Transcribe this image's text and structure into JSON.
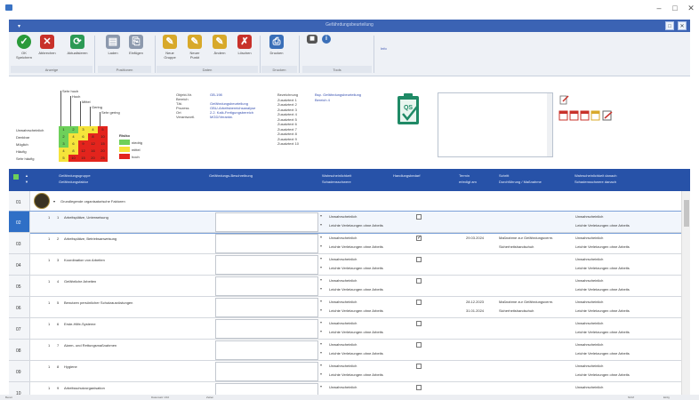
{
  "window": {
    "title": "Gefährdungsbeurteilung",
    "controls": {
      "minimize": "–",
      "maximize": "□",
      "close": "✕"
    }
  },
  "ribbon": {
    "groups": [
      {
        "name": "Anzeige",
        "buttons": [
          {
            "label": "OK Speichern",
            "icon": "check-icon",
            "color": "#2a9a3a"
          },
          {
            "label": "Abbrechen",
            "icon": "close-icon",
            "color": "#c8312a"
          },
          {
            "label": "Aktualisieren",
            "icon": "refresh-icon",
            "color": "#2c9a55"
          }
        ]
      },
      {
        "name": "Positionen",
        "buttons": [
          {
            "label": "Laden",
            "icon": "load-icon",
            "color": "#8c99ad"
          },
          {
            "label": "Einfügen",
            "icon": "insert-icon",
            "color": "#8c99ad"
          }
        ]
      },
      {
        "name": "Daten",
        "buttons": [
          {
            "label": "Neue Gruppe",
            "icon": "pencil-icon",
            "color": "#d8a92a"
          },
          {
            "label": "Neuer Punkt",
            "icon": "pencil-icon",
            "color": "#d8a92a"
          },
          {
            "label": "Ändern",
            "icon": "pencil-icon",
            "color": "#d8a92a"
          },
          {
            "label": "Löschen",
            "icon": "delete-icon",
            "color": "#c8312a"
          }
        ]
      },
      {
        "name": "Drucken",
        "buttons": [
          {
            "label": "Drucken",
            "icon": "printer-icon",
            "color": "#3a6fb8"
          }
        ]
      },
      {
        "name": "Tools",
        "buttons": [
          {
            "label": "",
            "icon": "camera-icon",
            "color": "#555"
          },
          {
            "label": "",
            "icon": "info-icon",
            "color": "#3a6fb8"
          }
        ]
      }
    ],
    "extra_label": "Info"
  },
  "matrix": {
    "row_labels": [
      "Unwahrscheinlich",
      "Denkbar",
      "Möglich",
      "Häufig",
      "Sehr häufig"
    ],
    "col_labels": [
      "Sehr gering",
      "Gering",
      "Mittel",
      "Hoch",
      "Sehr hoch"
    ],
    "cells": [
      [
        "gruen",
        "gruen",
        "gelb",
        "gelb",
        "rot"
      ],
      [
        "gruen",
        "gelb",
        "gelb",
        "rot",
        "rot"
      ],
      [
        "gruen",
        "gelb",
        "rot",
        "rot",
        "rot"
      ],
      [
        "gelb",
        "gelb",
        "rot",
        "rot",
        "rot"
      ],
      [
        "gelb",
        "rot",
        "rot",
        "rot",
        "rot"
      ]
    ],
    "cell_numbers": [
      [
        "1",
        "2",
        "3",
        "4",
        "5"
      ],
      [
        "2",
        "4",
        "6",
        "8",
        "10"
      ],
      [
        "3",
        "6",
        "9",
        "12",
        "15"
      ],
      [
        "4",
        "8",
        "12",
        "16",
        "20"
      ],
      [
        "5",
        "10",
        "15",
        "20",
        "25"
      ]
    ],
    "colors": {
      "gruen": "#6dd05a",
      "gelb": "#f5e33a",
      "rot": "#e3241d"
    },
    "legend_title": "Risiko",
    "legend": [
      {
        "label": "niedrig",
        "color": "#6dd05a"
      },
      {
        "label": "mittel",
        "color": "#f5e33a"
      },
      {
        "label": "hoch",
        "color": "#e3241d"
      }
    ]
  },
  "info_left": {
    "labels": [
      "Objekt-Nr.",
      "Bereich",
      "Tät.",
      "Prozess",
      "Ort",
      "Verantwortl."
    ],
    "values": [
      "GB-198",
      "",
      "Gefährdungsbeurteilung",
      "GBU-Arbeitsbereichsanalyse",
      "2.2. Kalk-Fertigungsbereich",
      "MGD/Verantw."
    ]
  },
  "info_mid": {
    "labels": [
      "Bezeichnung",
      "Zusatztext 1",
      "Zusatztext 2",
      "Zusatztext 3",
      "Zusatztext 4",
      "Zusatztext 5",
      "Zusatztext 6",
      "Zusatztext 7",
      "Zusatztext 8",
      "Zusatztext 9",
      "Zusatztext 10"
    ],
    "values": [
      "Bsp. Gefährdungsbeurteilung",
      "Bereich 4"
    ]
  },
  "table": {
    "headers": [
      {
        "l1": "Gefährdungsgruppe",
        "l2": "Gefährdungsfaktor"
      },
      {
        "l1": "Gefährdungs-Beschreibung",
        "l2": ""
      },
      {
        "l1": "Wahrscheinlichkeit",
        "l2": "Schadensschwere"
      },
      {
        "l1": "Handlungsbedarf",
        "l2": ""
      },
      {
        "l1": "Termin",
        "l2": "erledigt am"
      },
      {
        "l1": "Schritt",
        "l2": "Durchführung / Maßnahme"
      },
      {
        "l1": "Wahrscheinlichkeit danach",
        "l2": "Schadensschwere danach"
      }
    ],
    "group_row": {
      "num": "01",
      "text": "Grundlegende organisatorische Faktoren"
    },
    "rows": [
      {
        "num": "02",
        "a": "1",
        "b": "1",
        "title": "Arbeitsplätze, Unterweisung",
        "w": "Unwahrscheinlich",
        "s": "Leichte Verletzungen ohne Arbeits",
        "checked": false,
        "date1": "",
        "date2": "",
        "m1": "",
        "m2": "",
        "after1": "Unwahrscheinlich",
        "after2": "Leichte Verletzungen ohne Arbeits",
        "selected": true
      },
      {
        "num": "03",
        "a": "1",
        "b": "2",
        "title": "Arbeitsplätze, Betriebsanweisung",
        "w": "Unwahrscheinlich",
        "s": "Leichte Verletzungen ohne Arbeits",
        "checked": true,
        "date1": "29.03.2024",
        "date2": "",
        "m1": "Maßnahme zur Gefährdungsverm.",
        "m2": "Sicherheitshandschuh",
        "after1": "Unwahrscheinlich",
        "after2": "Leichte Verletzungen ohne Arbeits",
        "selected": false
      },
      {
        "num": "04",
        "a": "1",
        "b": "3",
        "title": "Koordination von Arbeiten",
        "w": "Unwahrscheinlich",
        "s": "Leichte Verletzungen ohne Arbeits",
        "checked": false,
        "date1": "",
        "date2": "",
        "m1": "",
        "m2": "",
        "after1": "Unwahrscheinlich",
        "after2": "Leichte Verletzungen ohne Arbeits",
        "selected": false
      },
      {
        "num": "05",
        "a": "1",
        "b": "4",
        "title": "Gefährliche Arbeiten",
        "w": "Unwahrscheinlich",
        "s": "Leichte Verletzungen ohne Arbeits",
        "checked": false,
        "date1": "",
        "date2": "",
        "m1": "",
        "m2": "",
        "after1": "Unwahrscheinlich",
        "after2": "Leichte Verletzungen ohne Arbeits",
        "selected": false
      },
      {
        "num": "06",
        "a": "1",
        "b": "5",
        "title": "Benutzen persönlicher Schutzausrüstungen",
        "w": "Unwahrscheinlich",
        "s": "Leichte Verletzungen ohne Arbeits",
        "checked": false,
        "date1": "28.12.2023",
        "date2": "31.01.2024",
        "m1": "Maßnahme zur Gefährdungsverm.",
        "m2": "Sicherheitshandschuh",
        "after1": "Unwahrscheinlich",
        "after2": "Leichte Verletzungen ohne Arbeits",
        "selected": false
      },
      {
        "num": "07",
        "a": "1",
        "b": "6",
        "title": "Erste-Hilfe-Systeme",
        "w": "Unwahrscheinlich",
        "s": "Leichte Verletzungen ohne Arbeits",
        "checked": false,
        "date1": "",
        "date2": "",
        "m1": "",
        "m2": "",
        "after1": "Unwahrscheinlich",
        "after2": "Leichte Verletzungen ohne Arbeits",
        "selected": false
      },
      {
        "num": "08",
        "a": "1",
        "b": "7",
        "title": "Alarm- und Rettungsmaßnahmen",
        "w": "Unwahrscheinlich",
        "s": "Leichte Verletzungen ohne Arbeits",
        "checked": false,
        "date1": "",
        "date2": "",
        "m1": "",
        "m2": "",
        "after1": "Unwahrscheinlich",
        "after2": "Leichte Verletzungen ohne Arbeits",
        "selected": false
      },
      {
        "num": "09",
        "a": "1",
        "b": "8",
        "title": "Hygiene",
        "w": "Unwahrscheinlich",
        "s": "Leichte Verletzungen ohne Arbeits",
        "checked": false,
        "date1": "",
        "date2": "",
        "m1": "",
        "m2": "",
        "after1": "Unwahrscheinlich",
        "after2": "Leichte Verletzungen ohne Arbeits",
        "selected": false
      },
      {
        "num": "10",
        "a": "1",
        "b": "9",
        "title": "Arbeitsschutzorganisation",
        "w": "Unwahrscheinlich",
        "s": "Leichte Verletzungen ohne Arbeits",
        "checked": false,
        "date1": "",
        "date2": "",
        "m1": "",
        "m2": "",
        "after1": "Unwahrscheinlich",
        "after2": "Leichte Verletzungen ohne Arbeits",
        "selected": false
      }
    ]
  },
  "status": {
    "left": "Bereit",
    "mid1": "Datensatz 1/10",
    "mid2": "Zeilen",
    "right1": "NUM",
    "right2": "Einfg"
  }
}
